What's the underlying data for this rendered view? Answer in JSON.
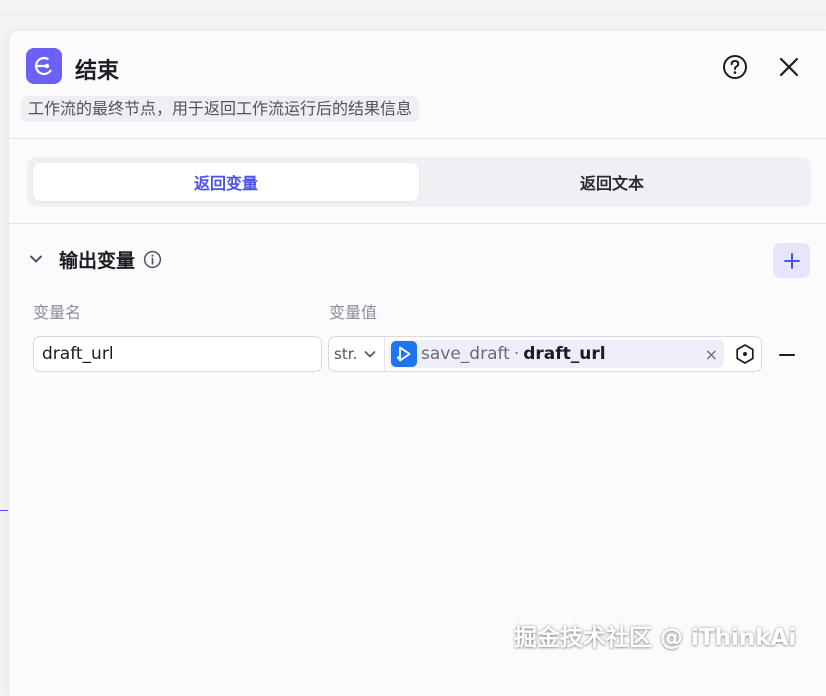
{
  "node": {
    "title": "结束",
    "description": "工作流的最终节点，用于返回工作流运行后的结果信息",
    "icon": "end-node-icon",
    "accent": "#6c61f6"
  },
  "tabs": [
    {
      "label": "返回变量",
      "active": true
    },
    {
      "label": "返回文本",
      "active": false
    }
  ],
  "output_section": {
    "title": "输出变量",
    "col_name": "变量名",
    "col_value": "变量值",
    "rows": [
      {
        "name": "draft_url",
        "type": "str.",
        "ref_node": "save_draft",
        "ref_separator": "·",
        "ref_field": "draft_url",
        "clear": "×"
      }
    ]
  },
  "watermark": "掘金技术社区 @ iThinkAi",
  "colors": {
    "active_tab": "#4d53e8",
    "ref_icon": "#1f74f0"
  }
}
